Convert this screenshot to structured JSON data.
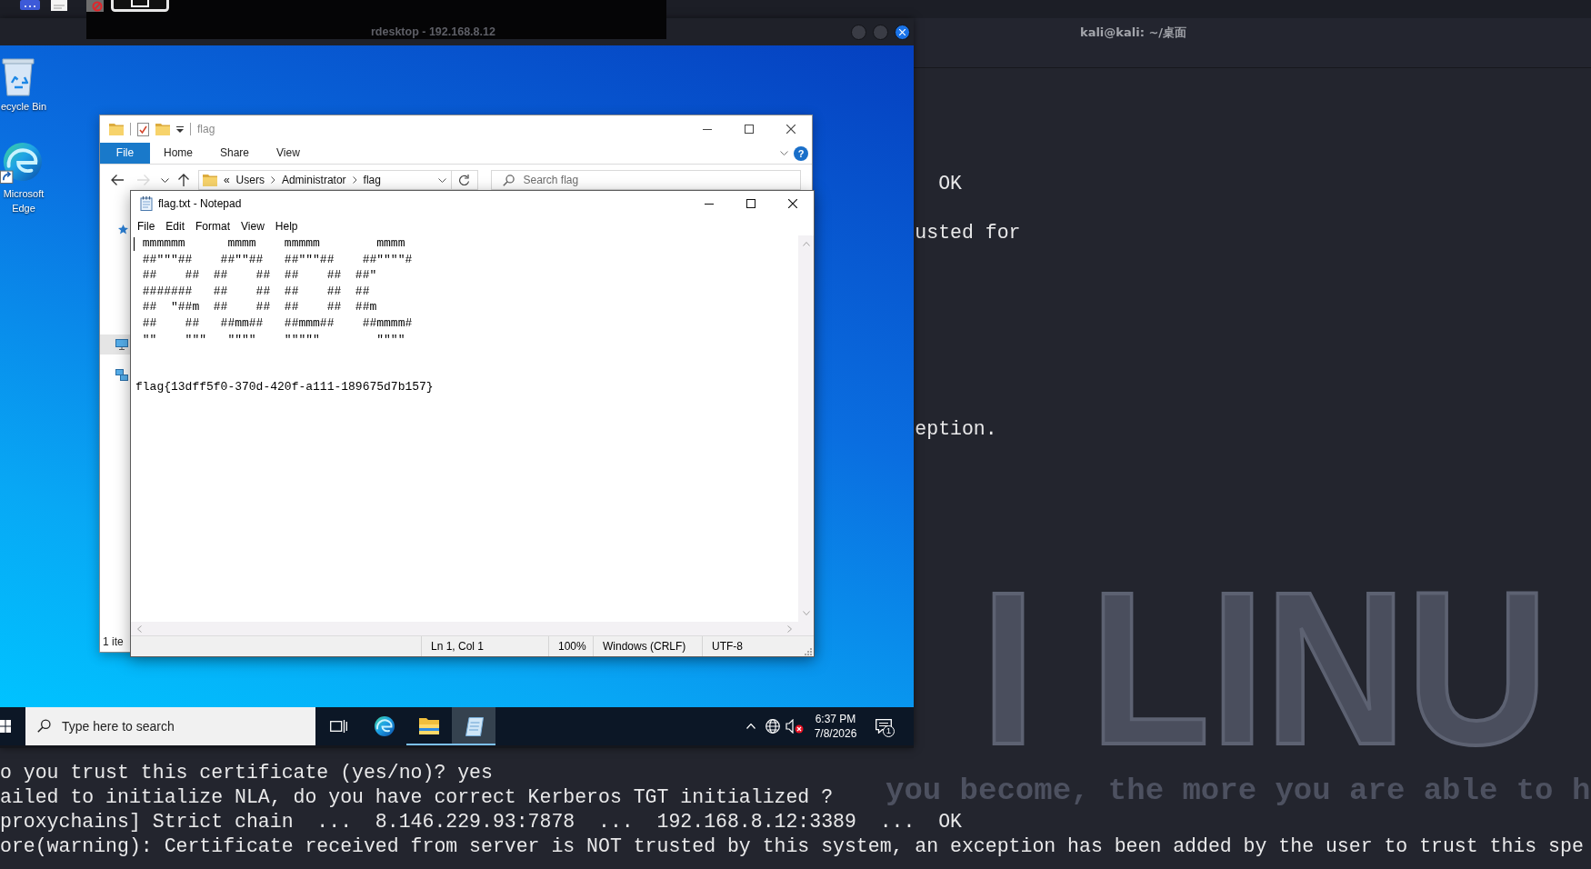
{
  "rdesktop": {
    "title": "rdesktop - 192.168.8.12"
  },
  "desktop": {
    "icons": [
      {
        "kind": "recycle-bin",
        "label": "ecycle Bin"
      },
      {
        "kind": "edge",
        "label": "Microsoft Edge"
      }
    ]
  },
  "explorer": {
    "title": "flag",
    "ribbon_tabs": [
      {
        "label": "File",
        "kind": "menu"
      },
      {
        "label": "Home",
        "kind": "tab"
      },
      {
        "label": "Share",
        "kind": "tab"
      },
      {
        "label": "View",
        "kind": "tab"
      }
    ],
    "help": "?",
    "nav_buttons": [
      {
        "kind": "back",
        "disabled": false
      },
      {
        "kind": "forward",
        "disabled": true
      },
      {
        "kind": "recent",
        "disabled": false
      },
      {
        "kind": "up",
        "disabled": false
      }
    ],
    "address": {
      "overflow": "«",
      "path": [
        "Users",
        "Administrator",
        "flag"
      ]
    },
    "search": {
      "placeholder": "Search flag"
    },
    "nav_items": [
      {
        "kind": "quick-access",
        "selected": false
      },
      {
        "kind": "this-pc",
        "selected": true
      },
      {
        "kind": "network",
        "selected": false
      }
    ],
    "status": "1 ite"
  },
  "notepad": {
    "title": "flag.txt - Notepad",
    "menu": [
      "File",
      "Edit",
      "Format",
      "View",
      "Help"
    ],
    "ascii_art": [
      " mmmmmm      mmmm    mmmmm        mmmm",
      " ##\"\"\"##    ##\"\"##   ##\"\"\"##    ##\"\"\"\"#",
      " ##    ##  ##    ##  ##    ##  ##\"",
      " #######   ##    ##  ##    ##  ##",
      " ##  \"##m  ##    ##  ##    ##  ##m",
      " ##    ##   ##mm##   ##mmm##    ##mmmm#",
      " \"\"    \"\"\"   \"\"\"\"    \"\"\"\"\"        \"\"\"\""
    ],
    "flag_line": "flag{13dff5f0-370d-420f-a111-189675d7b157}",
    "status_bar": [
      "Ln 1, Col 1",
      "100%",
      "Windows (CRLF)",
      "UTF-8"
    ]
  },
  "taskbar": {
    "search": {
      "placeholder": "Type here to search"
    },
    "apps": [
      {
        "kind": "task-view",
        "open": false,
        "active": false
      },
      {
        "kind": "edge",
        "open": false,
        "active": false
      },
      {
        "kind": "explorer",
        "open": true,
        "active": false
      },
      {
        "kind": "notepad",
        "open": true,
        "active": true
      }
    ],
    "tray": {
      "volume_muted": true
    },
    "clock": {
      "time": "6:37 PM",
      "date": "7/8/2026"
    },
    "notifications": "1"
  },
  "terminal": {
    "title": "kali@kali: ~/桌面",
    "upper_fragments": [
      "OK",
      "usted for",
      "eption."
    ],
    "lines": [
      "o you trust this certificate (yes/no)? yes",
      "ailed to initialize NLA, do you have correct Kerberos TGT initialized ?",
      "proxychains] Strict chain  ...  8.146.229.93:7878  ...  192.168.8.12:3389  ...  OK",
      "ore(warning): Certificate received from server is NOT trusted by this system, an exception has been added by the user to trust this spe"
    ]
  },
  "wallpaper": {
    "logo": "I LINU",
    "slogan": "you become, the more you are able to h"
  }
}
